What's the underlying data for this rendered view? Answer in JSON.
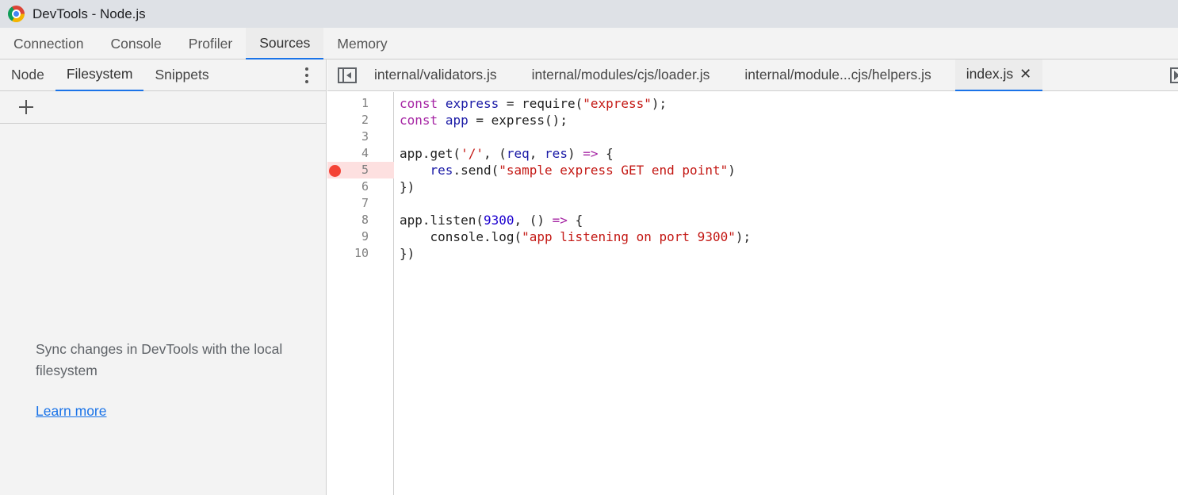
{
  "window": {
    "title": "DevTools - Node.js"
  },
  "main_tabs": [
    "Connection",
    "Console",
    "Profiler",
    "Sources",
    "Memory"
  ],
  "navigator": {
    "tabs": [
      "Node",
      "Filesystem",
      "Snippets"
    ],
    "sync_message": "Sync changes in DevTools with the local filesystem",
    "learn_more": "Learn more"
  },
  "editor_tabs": [
    "internal/validators.js",
    "internal/modules/cjs/loader.js",
    "internal/module...cjs/helpers.js",
    "index.js"
  ],
  "editor": {
    "close_glyph": "✕",
    "breakpoint_line": 5,
    "line_numbers": [
      "1",
      "2",
      "3",
      "4",
      "5",
      "6",
      "7",
      "8",
      "9",
      "10"
    ],
    "lines": [
      "const express = require(\"express\");",
      "const app = express();",
      "",
      "app.get('/', (req, res) => {",
      "    res.send(\"sample express GET end point\")",
      "})",
      "",
      "app.listen(9300, () => {",
      "    console.log(\"app listening on port 9300\");",
      "})"
    ]
  },
  "colors": {
    "accent": "#1a73e8",
    "breakpoint": "#f44336",
    "breakpoint_row": "#fde0e0",
    "keyword": "#a626a4",
    "string": "#c41a16",
    "number": "#1c00cf"
  }
}
